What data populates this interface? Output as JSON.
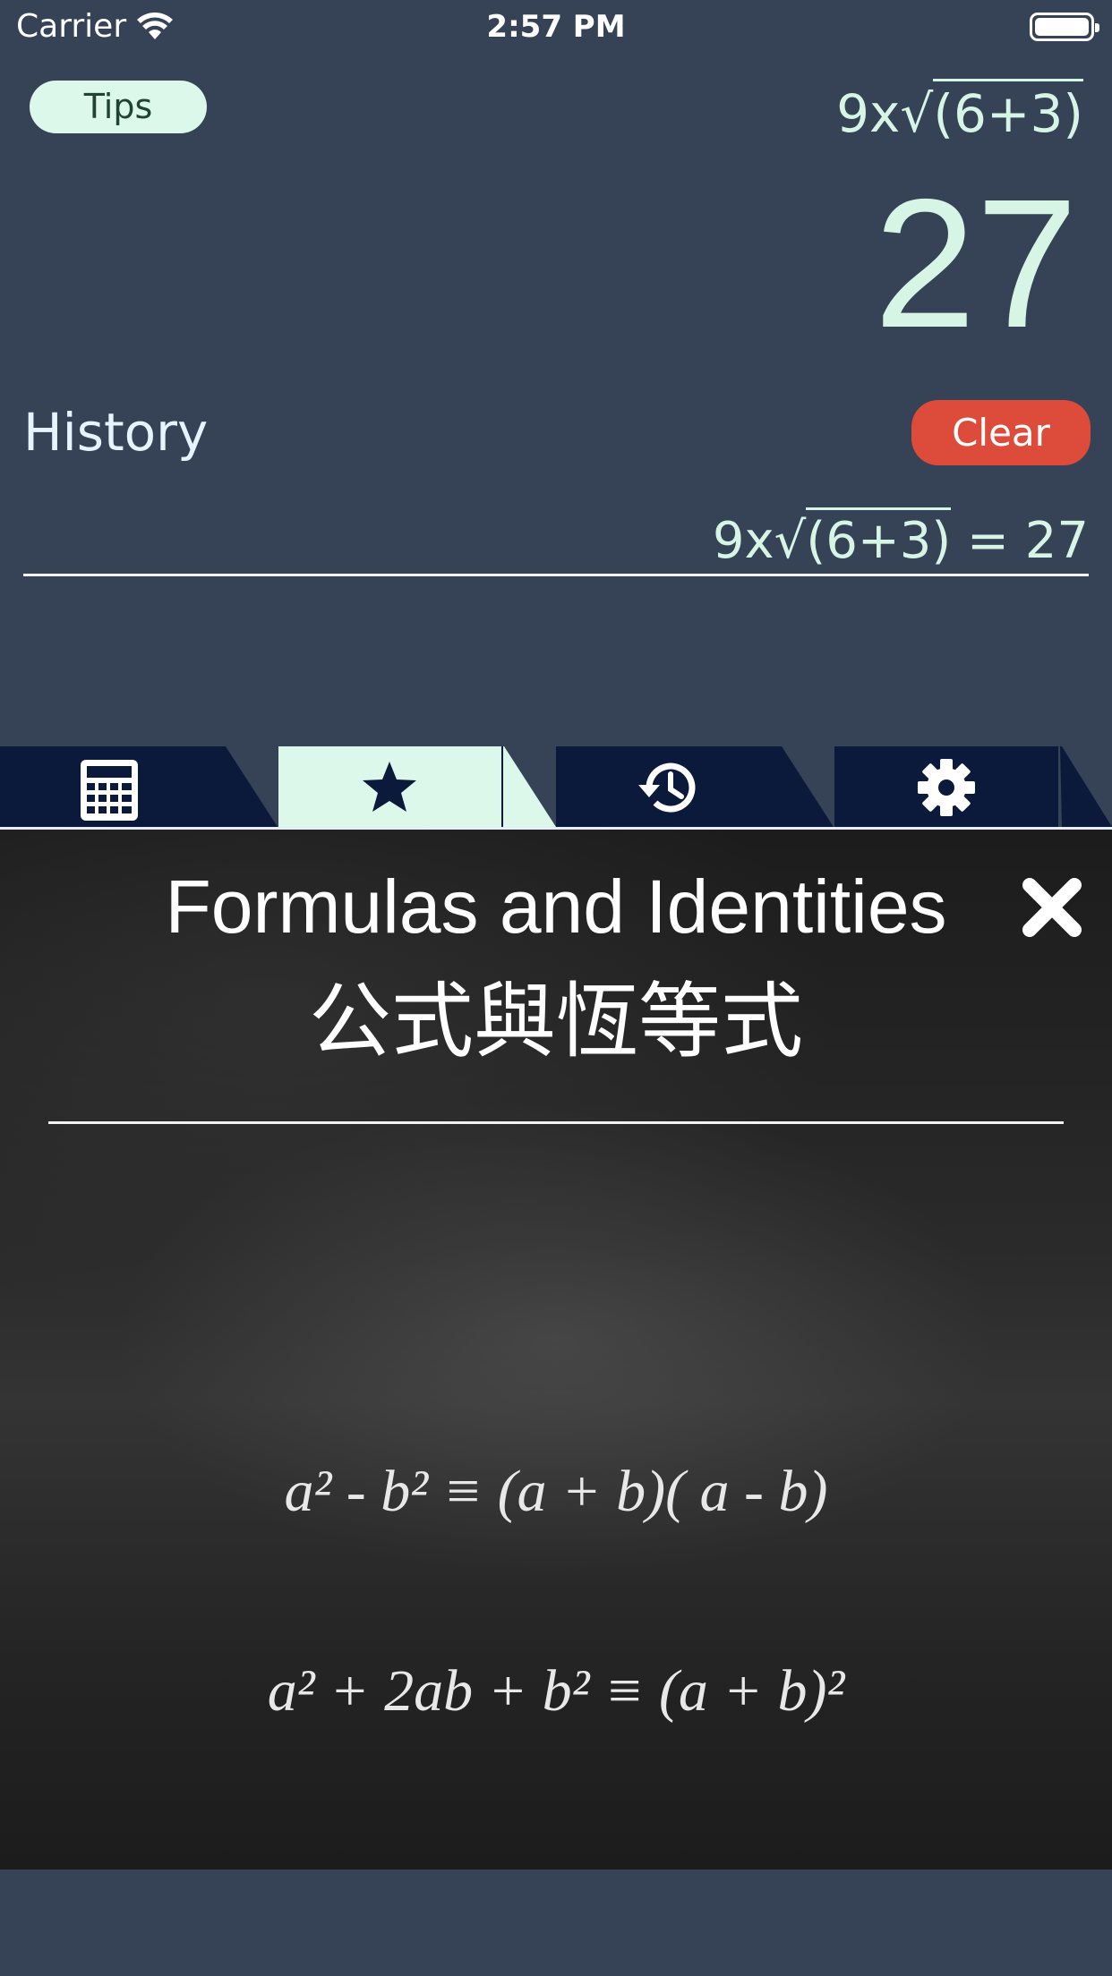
{
  "status_bar": {
    "carrier": "Carrier",
    "time": "2:57 PM",
    "wifi_icon": "wifi-icon",
    "battery_icon": "battery-icon"
  },
  "calculator": {
    "tips_label": "Tips",
    "expression": {
      "prefix": "9x√",
      "radicand": "(6+3)"
    },
    "result": "27",
    "history_label": "History",
    "clear_label": "Clear",
    "history_entries": [
      {
        "prefix": "9x√",
        "radicand": "(6+3)",
        "suffix": " = 27"
      }
    ]
  },
  "tabs": [
    {
      "name": "calculator",
      "icon": "calculator-icon",
      "selected": false
    },
    {
      "name": "favorites",
      "icon": "star-icon",
      "selected": true
    },
    {
      "name": "history",
      "icon": "history-icon",
      "selected": false
    },
    {
      "name": "settings",
      "icon": "gear-icon",
      "selected": false
    }
  ],
  "formulas_panel": {
    "title": "Formulas and Identities",
    "subtitle": "公式與恆等式",
    "close_icon": "close-icon",
    "formulas": [
      "a² - b² ≡ (a + b)( a - b)",
      "a² + 2ab + b² ≡ (a + b)²"
    ]
  },
  "colors": {
    "background": "#364256",
    "tab_bar": "#0b1a3a",
    "tab_selected": "#dcf8eb",
    "accent_text": "#d6f5e5",
    "clear_button": "#dd4b3b",
    "chalkboard": "#2a2a2a"
  }
}
